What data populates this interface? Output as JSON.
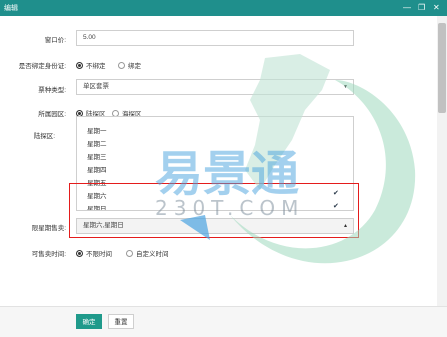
{
  "window": {
    "title": "编辑",
    "controls": [
      "—",
      "❐",
      "✕"
    ]
  },
  "form": {
    "price": {
      "label": "窗口价:",
      "value": "5.00"
    },
    "id_binding": {
      "label": "是否绑定身份证:",
      "options": [
        "不绑定",
        "绑定"
      ],
      "selected": "不绑定"
    },
    "ticket_type": {
      "label": "票种类型:",
      "value": "单区套票"
    },
    "park_area": {
      "label": "所属园区:",
      "options": [
        "陆探区",
        "海探区"
      ],
      "selected": "陆探区"
    },
    "land_area": {
      "label": "陆探区:"
    },
    "weekday_list": {
      "items": [
        {
          "label": "星期一",
          "checked": false
        },
        {
          "label": "星期二",
          "checked": false
        },
        {
          "label": "星期三",
          "checked": false
        },
        {
          "label": "星期四",
          "checked": false
        },
        {
          "label": "星期五",
          "checked": false
        },
        {
          "label": "星期六",
          "checked": true
        },
        {
          "label": "星期日",
          "checked": true
        }
      ]
    },
    "restricted_days": {
      "label": "限星期售卖:",
      "value": "星期六,星期日"
    },
    "sale_time": {
      "label": "可售卖时间:",
      "options": [
        "不限时间",
        "自定义时间"
      ],
      "selected": "不限时间"
    }
  },
  "footer": {
    "confirm_label": "确定",
    "reset_label": "重置"
  },
  "watermark": {
    "brand": "易景通",
    "site": "230T.COM"
  },
  "colors": {
    "accent": "#1f9a8b",
    "titlebar": "#1f8f8c",
    "highlight": "#e41c1c"
  }
}
